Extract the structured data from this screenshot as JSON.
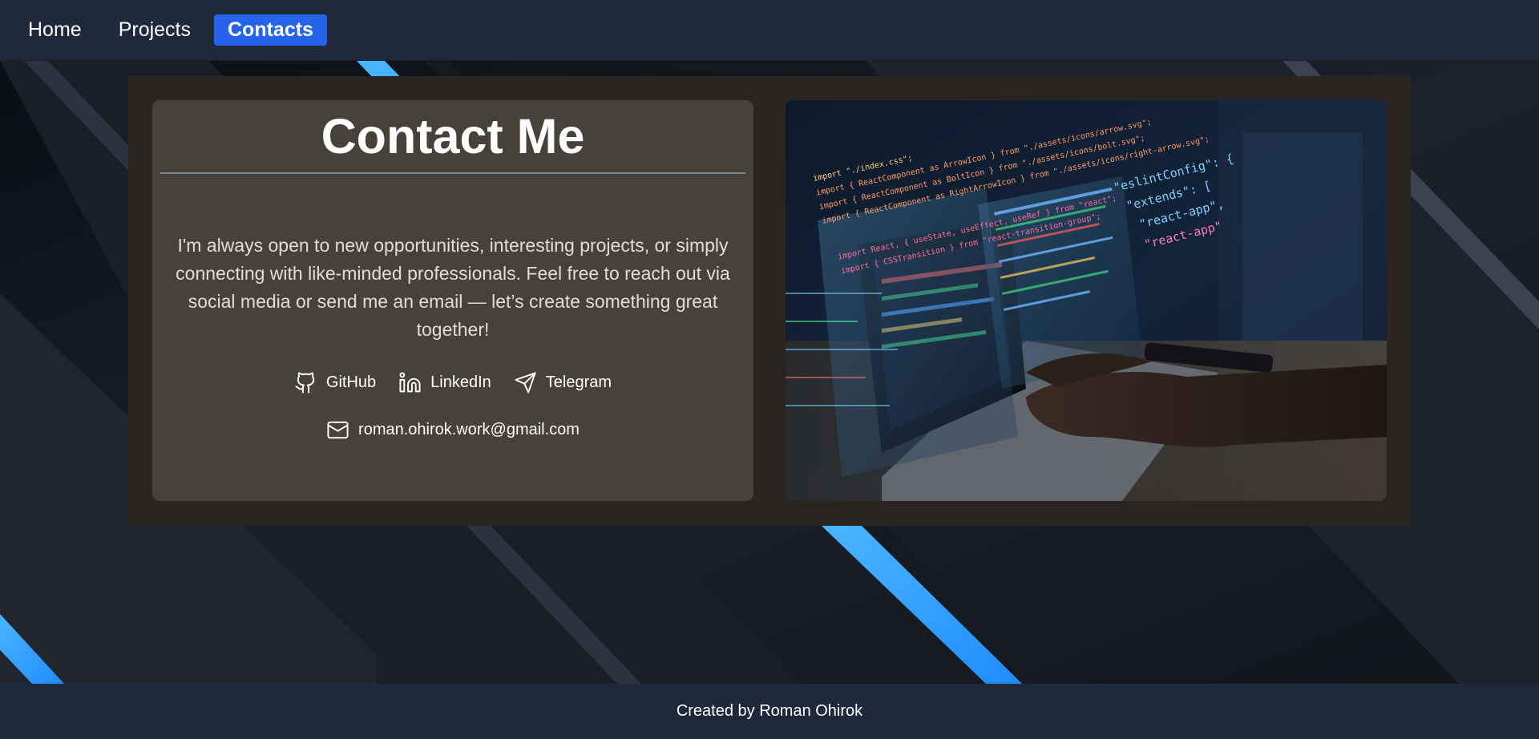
{
  "nav": {
    "items": [
      {
        "label": "Home",
        "active": false
      },
      {
        "label": "Projects",
        "active": false
      },
      {
        "label": "Contacts",
        "active": true
      }
    ]
  },
  "contact": {
    "title": "Contact Me",
    "description": "I'm always open to new opportunities, interesting projects, or simply connecting with like-minded professionals. Feel free to reach out via social media or send me an email — let’s create something great together!",
    "links": [
      {
        "label": "GitHub",
        "icon": "github-icon"
      },
      {
        "label": "LinkedIn",
        "icon": "linkedin-icon"
      },
      {
        "label": "Telegram",
        "icon": "telegram-icon"
      }
    ],
    "email": {
      "label": "roman.ohirok.work@gmail.com",
      "icon": "mail-icon"
    }
  },
  "image": {
    "code_lines": [
      "import \"./index.css\";",
      "import { ReactComponent as ArrowIcon } from \"./assets/icons/arrow.svg\";",
      "import { ReactComponent as BoltIcon } from \"./assets/icons/bolt.svg\";",
      "import { ReactComponent as RightArrowIcon } from \"./assets/icons/right-arrow.svg\";",
      "import React, { useState, useEffect, useRef } from \"react\";",
      "import { CSSTransition } from \"react-transition-group\";"
    ],
    "config_lines": [
      "\"eslintConfig\": {",
      "\"extends\": [",
      "\"react-app\",",
      "\"react-app\""
    ]
  },
  "footer": {
    "text": "Created by Roman Ohirok"
  },
  "colors": {
    "accent": "#2563eb",
    "header_bg": "#1e293b",
    "card_bg": "#46413b",
    "container_bg": "#2a2522",
    "stripe_blue": "#3aa9ff"
  }
}
